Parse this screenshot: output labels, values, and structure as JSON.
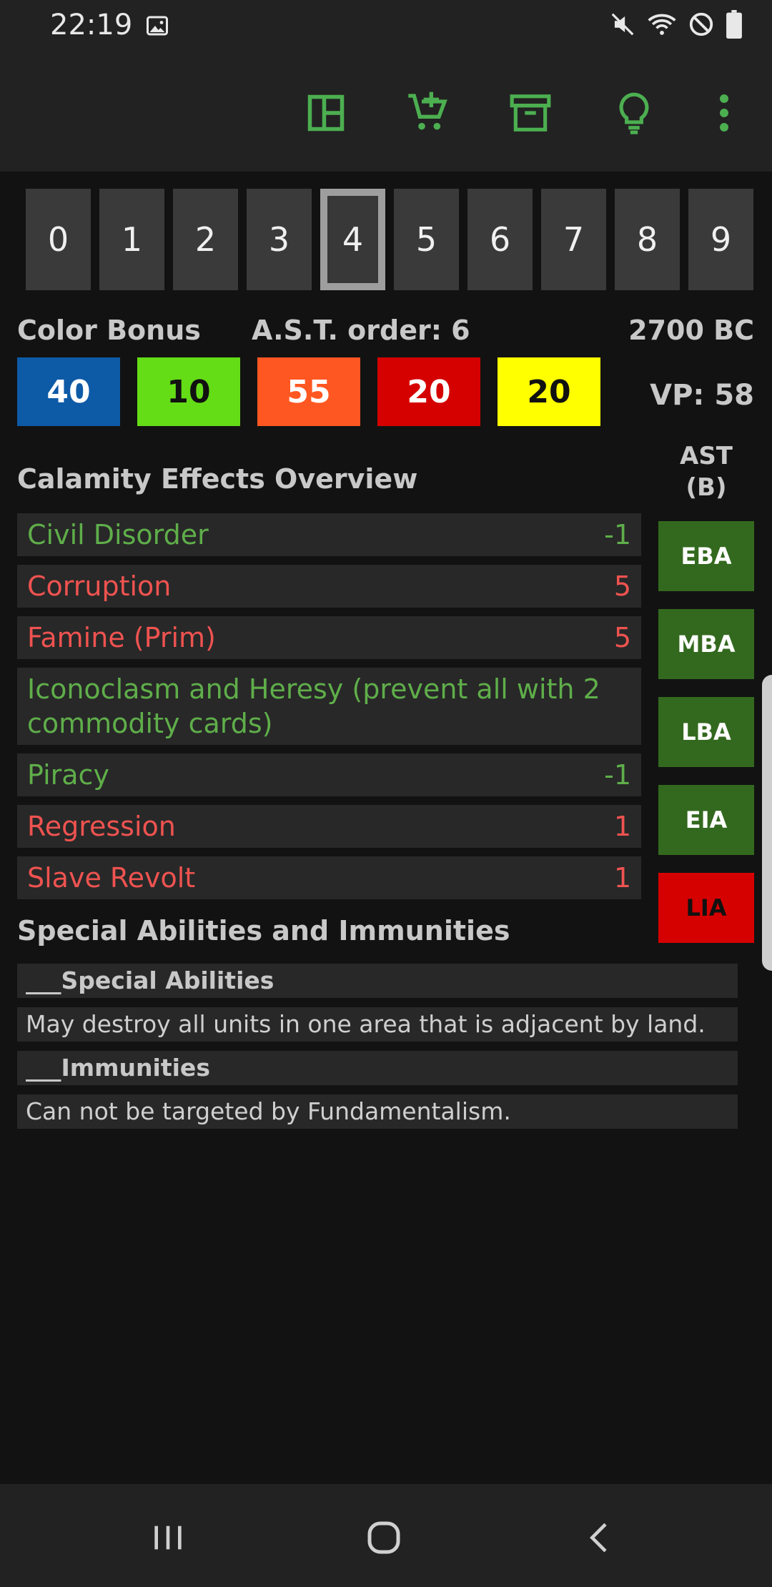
{
  "status": {
    "time": "22:19"
  },
  "toolbar": {
    "icons": [
      "layout-icon",
      "add-cart-icon",
      "archive-icon",
      "lightbulb-icon",
      "more-vert-icon"
    ],
    "accent": "#4caf50"
  },
  "digits": [
    "0",
    "1",
    "2",
    "3",
    "4",
    "5",
    "6",
    "7",
    "8",
    "9"
  ],
  "selected_digit": "4",
  "info": {
    "color_bonus_label": "Color Bonus",
    "ast_order": "A.S.T. order: 6",
    "date": "2700 BC",
    "vp": "VP: 58"
  },
  "color_bonus": [
    {
      "value": "40",
      "bg": "#0d5aa7",
      "fg": "#ffffff"
    },
    {
      "value": "10",
      "bg": "#64dd17",
      "fg": "#111111"
    },
    {
      "value": "55",
      "bg": "#ff5722",
      "fg": "#ffffff"
    },
    {
      "value": "20",
      "bg": "#d50000",
      "fg": "#ffffff"
    },
    {
      "value": "20",
      "bg": "#ffff00",
      "fg": "#111111"
    }
  ],
  "calamity": {
    "title": "Calamity Effects Overview",
    "items": [
      {
        "name": "Civil Disorder",
        "value": "-1",
        "color": "green"
      },
      {
        "name": "Corruption",
        "value": "5",
        "color": "red"
      },
      {
        "name": "Famine (Prim)",
        "value": "5",
        "color": "red"
      },
      {
        "name": "Iconoclasm and Heresy (prevent all with 2 commodity cards)",
        "value": "",
        "color": "green"
      },
      {
        "name": "Piracy",
        "value": "-1",
        "color": "green"
      },
      {
        "name": "Regression",
        "value": "1",
        "color": "red"
      },
      {
        "name": "Slave Revolt",
        "value": "1",
        "color": "red"
      }
    ]
  },
  "ast": {
    "header": "AST\n(B)",
    "items": [
      {
        "label": "EBA",
        "bg": "#33691e",
        "fg": "#ffffff"
      },
      {
        "label": "MBA",
        "bg": "#33691e",
        "fg": "#ffffff"
      },
      {
        "label": "LBA",
        "bg": "#33691e",
        "fg": "#ffffff"
      },
      {
        "label": "EIA",
        "bg": "#33691e",
        "fg": "#ffffff"
      },
      {
        "label": "LIA",
        "bg": "#d50000",
        "fg": "#111111"
      }
    ]
  },
  "special": {
    "title": "Special Abilities and Immunities",
    "abilities_head": "___Special Abilities",
    "abilities_text": "May destroy all units in one area that is adjacent by land.",
    "immunities_head": "___Immunities",
    "immunities_text": "Can not be targeted by Fundamentalism."
  },
  "nav": [
    "recents-icon",
    "home-icon",
    "back-icon"
  ]
}
